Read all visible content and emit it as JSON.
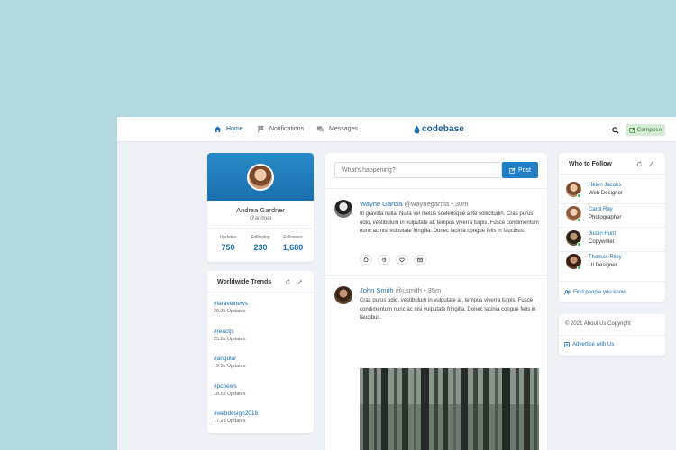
{
  "nav": {
    "home": "Home",
    "notifications": "Notifications",
    "messages": "Messages",
    "logo": "codebase",
    "compose": "Compose"
  },
  "profile": {
    "name": "Andrea Gardner",
    "handle": "@andrea",
    "stats": [
      {
        "label": "Updates",
        "value": "750"
      },
      {
        "label": "Following",
        "value": "230"
      },
      {
        "label": "Followers",
        "value": "1,680"
      }
    ]
  },
  "trends": {
    "title": "Worldwide Trends",
    "items": [
      {
        "tag": "#laravelnews",
        "count": "29.3k Updates"
      },
      {
        "tag": "#reactjs",
        "count": "25.8k Updates"
      },
      {
        "tag": "#angular",
        "count": "19.3k Updates"
      },
      {
        "tag": "#pcnews",
        "count": "18.6k Updates"
      },
      {
        "tag": "#webdesign2018",
        "count": "17.2k Updates"
      }
    ]
  },
  "composer": {
    "placeholder": "What's happening?",
    "post_label": "Post"
  },
  "posts": [
    {
      "author": "Wayne Garcia",
      "meta": " @waynegarcia • 30m",
      "text": "In gravida nulla. Nulla vel metus scelerisque ante sollicitudin. Cras purus odio, vestibulum in vulputate at, tempus viverra turpis. Fusce condimentum nunc ac nisi vulputate fringilla. Donec lacinia congue felis in faucibus."
    },
    {
      "author": "John Smith",
      "meta": " @j.smith • 35m",
      "text": "Cras purus odio, vestibulum in vulputate at, tempus viverra turpis. Fusce condimentum nunc ac nisi vulputate fringilla. Donec lacinia congue felis in faucibus."
    }
  ],
  "who_to_follow": {
    "title": "Who to Follow",
    "people": [
      {
        "name": "Helen Jacobs",
        "role": "Web Designer"
      },
      {
        "name": "Carol Ray",
        "role": "Photographer"
      },
      {
        "name": "Justin Hunt",
        "role": "Copywriter"
      },
      {
        "name": "Thomas Riley",
        "role": "UI Designer"
      }
    ],
    "find_label": "Find people you know"
  },
  "footer": {
    "copyright": "© 2021  About Us  Copyright",
    "advertise": "Advertise with Us"
  },
  "colors": {
    "accent": "#1a6fae",
    "online": "#3bb54a",
    "page_bg": "#b3d8de"
  }
}
